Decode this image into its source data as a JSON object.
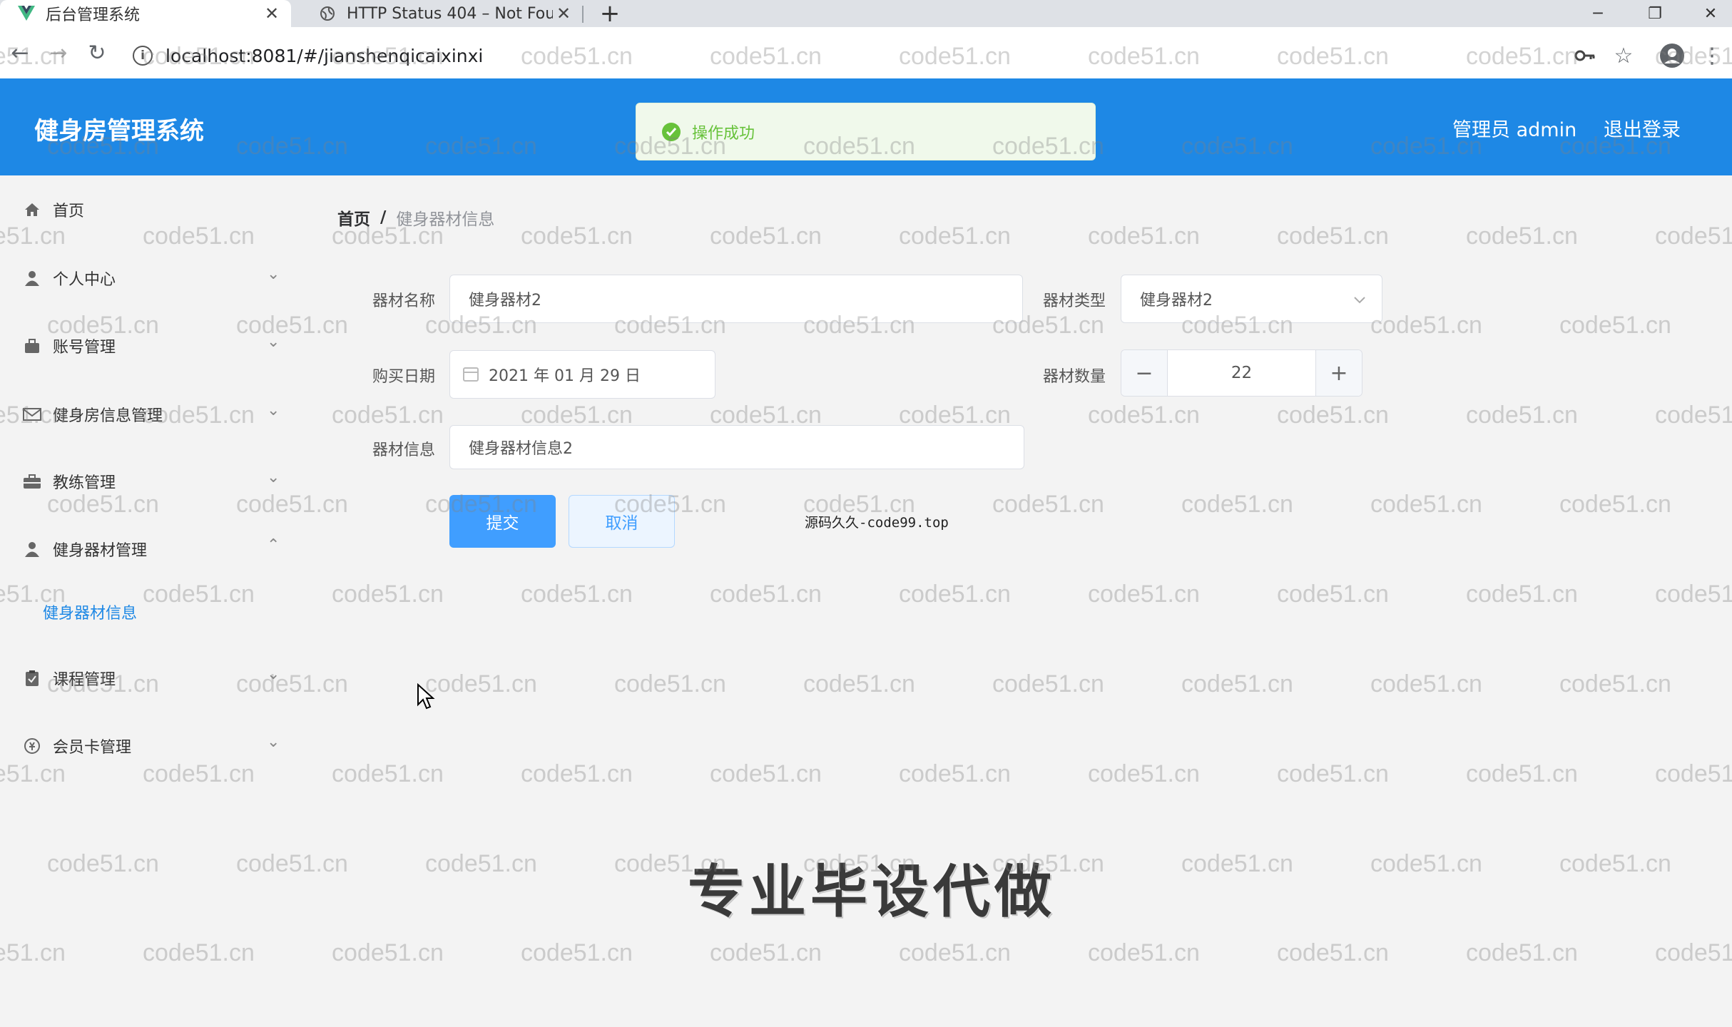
{
  "browser": {
    "tabs": [
      {
        "title": "后台管理系统",
        "active": true
      },
      {
        "title": "HTTP Status 404 – Not Found",
        "active": false
      }
    ],
    "url": "localhost:8081/#/jianshenqicaixinxi"
  },
  "header": {
    "app_title": "健身房管理系统",
    "admin_label": "管理员 admin",
    "logout_label": "退出登录",
    "color": "#1e88e5"
  },
  "toast": {
    "message": "操作成功",
    "color": "#67c23a"
  },
  "sidebar": {
    "items": [
      {
        "label": "首页",
        "icon": "home-icon"
      },
      {
        "label": "个人中心",
        "icon": "user-icon"
      },
      {
        "label": "账号管理",
        "icon": "account-icon"
      },
      {
        "label": "健身房信息管理",
        "icon": "mail-icon"
      },
      {
        "label": "教练管理",
        "icon": "briefcase-icon"
      },
      {
        "label": "健身器材管理",
        "icon": "user-icon"
      },
      {
        "label": "课程管理",
        "icon": "clipboard-icon"
      },
      {
        "label": "会员卡管理",
        "icon": "card-icon"
      }
    ],
    "sub_item": "健身器材信息"
  },
  "breadcrumb": {
    "home": "首页",
    "separator": "/",
    "current": "健身器材信息"
  },
  "form": {
    "name_label": "器材名称",
    "name_value": "健身器材2",
    "type_label": "器材类型",
    "type_value": "健身器材2",
    "date_label": "购买日期",
    "date_value": "2021 年 01 月 29 日",
    "qty_label": "器材数量",
    "qty_value": "22",
    "info_label": "器材信息",
    "info_value": "健身器材信息2",
    "submit_label": "提交",
    "cancel_label": "取消"
  },
  "overlay": {
    "source_text": "源码久久-code99.top",
    "banner": "专业毕设代做",
    "watermark": "code51.cn"
  }
}
